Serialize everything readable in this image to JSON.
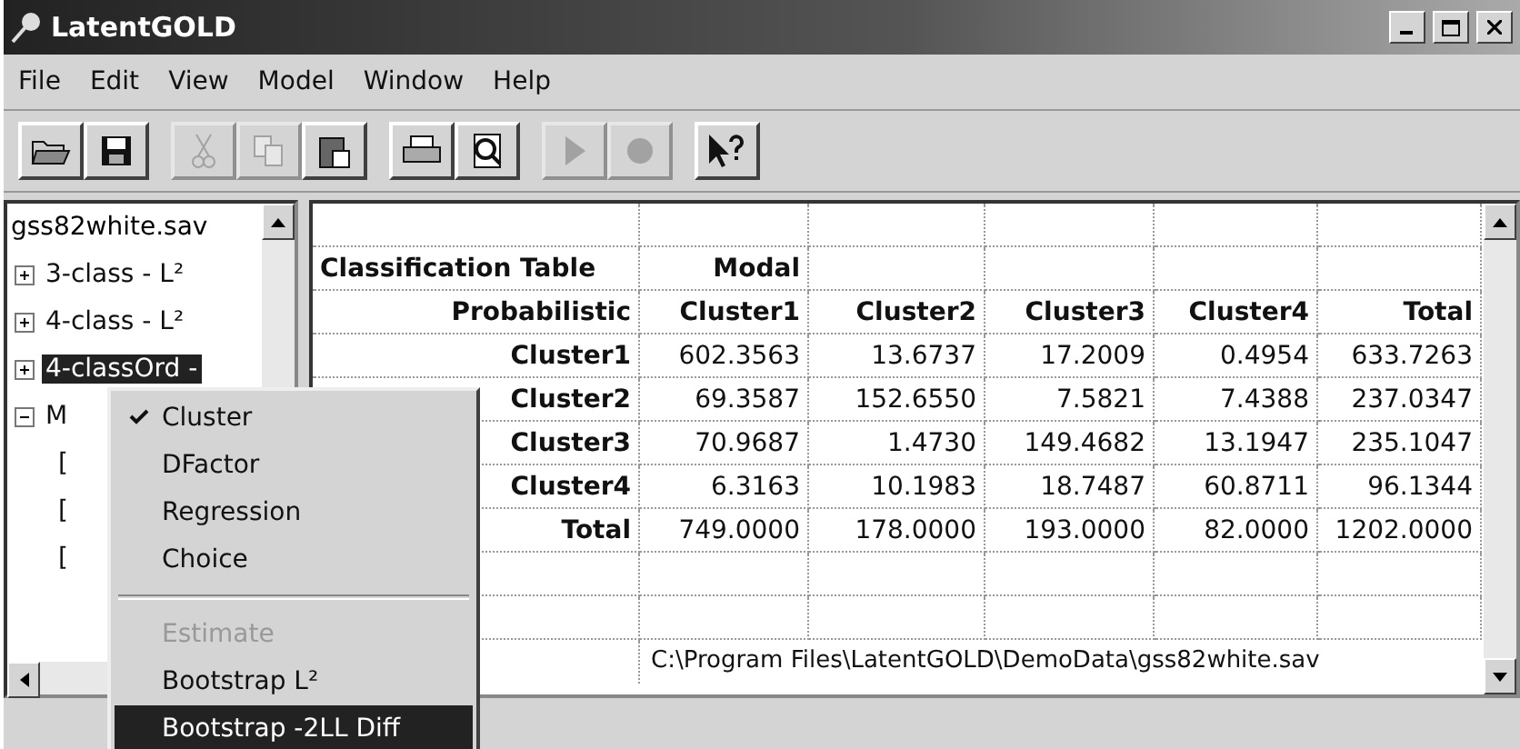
{
  "window": {
    "title": "LatentGOLD"
  },
  "menu": [
    "File",
    "Edit",
    "View",
    "Model",
    "Window",
    "Help"
  ],
  "toolbar": [
    {
      "kind": "open",
      "disabled": false
    },
    {
      "kind": "save",
      "disabled": false
    },
    {
      "kind": "gap"
    },
    {
      "kind": "cut",
      "disabled": true
    },
    {
      "kind": "copy",
      "disabled": true
    },
    {
      "kind": "paste",
      "disabled": false
    },
    {
      "kind": "gap"
    },
    {
      "kind": "print",
      "disabled": false
    },
    {
      "kind": "preview",
      "disabled": false
    },
    {
      "kind": "gap"
    },
    {
      "kind": "run",
      "disabled": true
    },
    {
      "kind": "stop",
      "disabled": true
    },
    {
      "kind": "gap"
    },
    {
      "kind": "help",
      "disabled": false
    }
  ],
  "tree": {
    "root": "gss82white.sav",
    "items": [
      {
        "label": "3-class - L²",
        "expanded": false,
        "selected": false
      },
      {
        "label": "4-class - L²",
        "expanded": false,
        "selected": false
      },
      {
        "label": "4-classOrd -",
        "expanded": false,
        "selected": true
      },
      {
        "label": "M",
        "expanded": true,
        "selected": false,
        "children": [
          {
            "label": "["
          },
          {
            "label": "["
          },
          {
            "label": "["
          }
        ]
      }
    ]
  },
  "table": {
    "rows": [
      {
        "kind": "blank",
        "cells": []
      },
      {
        "kind": "title",
        "cells": [
          "Classification Table",
          "Modal"
        ]
      },
      {
        "kind": "header",
        "cells": [
          "Probabilistic",
          "Cluster1",
          "Cluster2",
          "Cluster3",
          "Cluster4",
          "Total"
        ]
      },
      {
        "kind": "data",
        "cells": [
          "Cluster1",
          "602.3563",
          "13.6737",
          "17.2009",
          "0.4954",
          "633.7263"
        ]
      },
      {
        "kind": "data",
        "cells": [
          "Cluster2",
          "69.3587",
          "152.6550",
          "7.5821",
          "7.4388",
          "237.0347"
        ]
      },
      {
        "kind": "data",
        "cells": [
          "Cluster3",
          "70.9687",
          "1.4730",
          "149.4682",
          "13.1947",
          "235.1047"
        ]
      },
      {
        "kind": "data",
        "cells": [
          "Cluster4",
          "6.3163",
          "10.1983",
          "18.7487",
          "60.8711",
          "96.1344"
        ]
      },
      {
        "kind": "data",
        "cells": [
          "Total",
          "749.0000",
          "178.0000",
          "193.0000",
          "82.0000",
          "1202.0000"
        ]
      },
      {
        "kind": "blank",
        "cells": []
      },
      {
        "kind": "blank",
        "cells": []
      },
      {
        "kind": "path",
        "cells": [
          "",
          "C:\\Program Files\\LatentGOLD\\DemoData\\gss82white.sav"
        ]
      }
    ]
  },
  "context_menu": [
    {
      "kind": "item",
      "label": "Cluster",
      "checked": true,
      "disabled": false,
      "selected": false
    },
    {
      "kind": "item",
      "label": "DFactor",
      "checked": false,
      "disabled": false,
      "selected": false
    },
    {
      "kind": "item",
      "label": "Regression",
      "checked": false,
      "disabled": false,
      "selected": false
    },
    {
      "kind": "item",
      "label": "Choice",
      "checked": false,
      "disabled": false,
      "selected": false
    },
    {
      "kind": "separator"
    },
    {
      "kind": "item",
      "label": "Estimate",
      "checked": false,
      "disabled": true,
      "selected": false
    },
    {
      "kind": "item",
      "label": "Bootstrap L²",
      "checked": false,
      "disabled": false,
      "selected": false
    },
    {
      "kind": "item",
      "label": "Bootstrap -2LL Diff",
      "checked": false,
      "disabled": false,
      "selected": true
    }
  ]
}
